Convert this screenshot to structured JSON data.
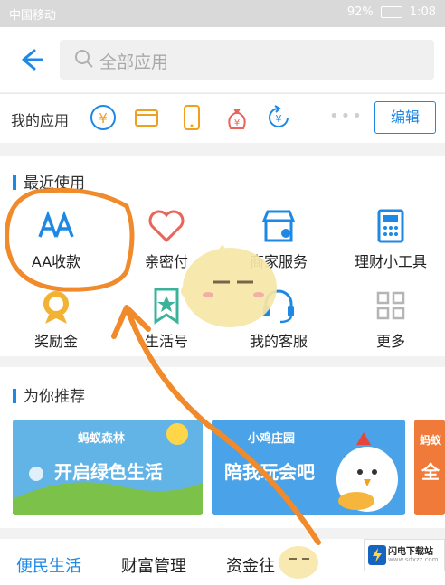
{
  "statusbar": {
    "carrier": "中国移动",
    "battery": "92%",
    "time": "1:08"
  },
  "search": {
    "placeholder": "全部应用"
  },
  "my_apps": {
    "label": "我的应用",
    "dots": "•••",
    "edit_label": "编辑",
    "icons": [
      "yen-circle-icon",
      "wallet-card-icon",
      "phone-icon",
      "money-bag-icon",
      "refresh-yen-icon"
    ]
  },
  "recent": {
    "title": "最近使用",
    "items": [
      {
        "label": "AA收款",
        "icon": "aa-split-icon"
      },
      {
        "label": "亲密付",
        "icon": "heart-icon"
      },
      {
        "label": "商家服务",
        "icon": "storefront-icon"
      },
      {
        "label": "理财小工具",
        "icon": "calculator-icon"
      },
      {
        "label": "奖励金",
        "icon": "reward-icon"
      },
      {
        "label": "生活号",
        "icon": "star-badge-icon"
      },
      {
        "label": "我的客服",
        "icon": "headset-icon"
      },
      {
        "label": "更多",
        "icon": "grid-more-icon"
      }
    ]
  },
  "recommend": {
    "title": "为你推荐",
    "cards": [
      {
        "small": "蚂蚁森林",
        "big": "开启绿色生活"
      },
      {
        "small": "小鸡庄园",
        "big": "陪我玩会吧"
      },
      {
        "small": "蚂蚁",
        "big": "全"
      }
    ]
  },
  "tabs": [
    {
      "label": "便民生活",
      "active": true
    },
    {
      "label": "财富管理",
      "active": false
    },
    {
      "label": "资金往",
      "active": false
    }
  ],
  "badge": {
    "title": "闪电下载站",
    "sub": "www.sdxzz.com"
  },
  "colors": {
    "accent": "#1e88e5",
    "annotation": "#f08a2a"
  }
}
